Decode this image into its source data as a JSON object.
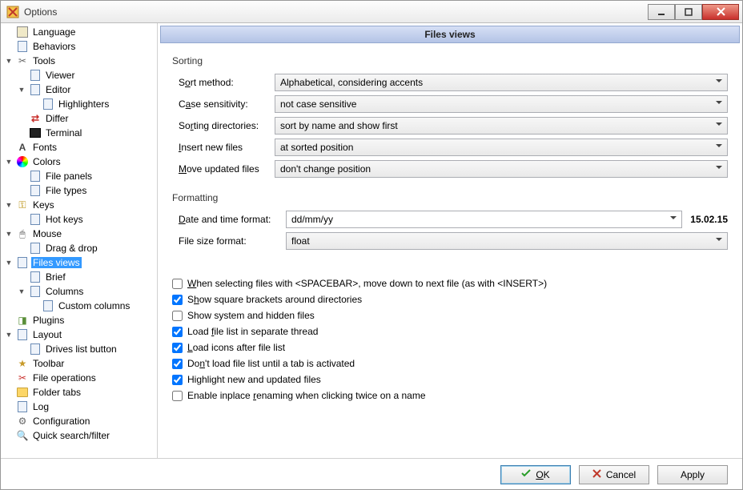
{
  "window": {
    "title": "Options"
  },
  "tree": [
    {
      "depth": 0,
      "twisty": "",
      "label": "Language",
      "icon": "lang"
    },
    {
      "depth": 0,
      "twisty": "",
      "label": "Behaviors",
      "icon": "page"
    },
    {
      "depth": 0,
      "twisty": "▼",
      "label": "Tools",
      "icon": "tool"
    },
    {
      "depth": 1,
      "twisty": "",
      "label": "Viewer",
      "icon": "page"
    },
    {
      "depth": 1,
      "twisty": "▼",
      "label": "Editor",
      "icon": "page"
    },
    {
      "depth": 2,
      "twisty": "",
      "label": "Highlighters",
      "icon": "page"
    },
    {
      "depth": 1,
      "twisty": "",
      "label": "Differ",
      "icon": "diff"
    },
    {
      "depth": 1,
      "twisty": "",
      "label": "Terminal",
      "icon": "term"
    },
    {
      "depth": 0,
      "twisty": "",
      "label": "Fonts",
      "icon": "font"
    },
    {
      "depth": 0,
      "twisty": "▼",
      "label": "Colors",
      "icon": "color"
    },
    {
      "depth": 1,
      "twisty": "",
      "label": "File panels",
      "icon": "page"
    },
    {
      "depth": 1,
      "twisty": "",
      "label": "File types",
      "icon": "page"
    },
    {
      "depth": 0,
      "twisty": "▼",
      "label": "Keys",
      "icon": "key"
    },
    {
      "depth": 1,
      "twisty": "",
      "label": "Hot keys",
      "icon": "page"
    },
    {
      "depth": 0,
      "twisty": "▼",
      "label": "Mouse",
      "icon": "mouse"
    },
    {
      "depth": 1,
      "twisty": "",
      "label": "Drag & drop",
      "icon": "page"
    },
    {
      "depth": 0,
      "twisty": "▼",
      "label": "Files views",
      "icon": "page",
      "selected": true
    },
    {
      "depth": 1,
      "twisty": "",
      "label": "Brief",
      "icon": "page"
    },
    {
      "depth": 1,
      "twisty": "▼",
      "label": "Columns",
      "icon": "page"
    },
    {
      "depth": 2,
      "twisty": "",
      "label": "Custom columns",
      "icon": "page"
    },
    {
      "depth": 0,
      "twisty": "",
      "label": "Plugins",
      "icon": "plug"
    },
    {
      "depth": 0,
      "twisty": "▼",
      "label": "Layout",
      "icon": "layout"
    },
    {
      "depth": 1,
      "twisty": "",
      "label": "Drives list button",
      "icon": "page"
    },
    {
      "depth": 0,
      "twisty": "",
      "label": "Toolbar",
      "icon": "toolbar"
    },
    {
      "depth": 0,
      "twisty": "",
      "label": "File operations",
      "icon": "fileop"
    },
    {
      "depth": 0,
      "twisty": "",
      "label": "Folder tabs",
      "icon": "folder"
    },
    {
      "depth": 0,
      "twisty": "",
      "label": "Log",
      "icon": "page"
    },
    {
      "depth": 0,
      "twisty": "",
      "label": "Configuration",
      "icon": "config"
    },
    {
      "depth": 0,
      "twisty": "",
      "label": "Quick search/filter",
      "icon": "search"
    }
  ],
  "main": {
    "header": "Files views",
    "sorting": {
      "group": "Sorting",
      "sort_method_label_pre": "S",
      "sort_method_label_u": "o",
      "sort_method_label_post": "rt method:",
      "sort_method_value": "Alphabetical, considering accents",
      "case_label_pre": "C",
      "case_label_u": "a",
      "case_label_post": "se sensitivity:",
      "case_value": "not case sensitive",
      "dirs_label_pre": "So",
      "dirs_label_u": "r",
      "dirs_label_post": "ting directories:",
      "dirs_value": "sort by name and show first",
      "insert_label_u": "I",
      "insert_label_post": "nsert new files",
      "insert_value": "at sorted position",
      "move_label_u": "M",
      "move_label_post": "ove updated files",
      "move_value": "don't change position"
    },
    "formatting": {
      "group": "Formatting",
      "date_label_u": "D",
      "date_label_post": "ate and time format:",
      "date_value": "dd/mm/yy",
      "date_preview": "15.02.15",
      "size_label": "File size format:",
      "size_value": "float"
    },
    "checks": [
      {
        "checked": false,
        "pre": "",
        "u": "W",
        "post": "hen selecting files with <SPACEBAR>, move down to next file (as with <INSERT>)"
      },
      {
        "checked": true,
        "pre": "S",
        "u": "h",
        "post": "ow square brackets around directories"
      },
      {
        "checked": false,
        "pre": "Show system and hidden files",
        "u": "",
        "post": ""
      },
      {
        "checked": true,
        "pre": "Load ",
        "u": "f",
        "post": "ile list in separate thread"
      },
      {
        "checked": true,
        "pre": "",
        "u": "L",
        "post": "oad icons after file list"
      },
      {
        "checked": true,
        "pre": "Do",
        "u": "n",
        "post": "'t load file list until a tab is activated"
      },
      {
        "checked": true,
        "pre": "Highlight new and updated files",
        "u": "",
        "post": ""
      },
      {
        "checked": false,
        "pre": "Enable inplace ",
        "u": "r",
        "post": "enaming when clicking twice on a name"
      }
    ]
  },
  "buttons": {
    "ok_u": "O",
    "ok_post": "K",
    "cancel": "Cancel",
    "apply": "Apply"
  }
}
